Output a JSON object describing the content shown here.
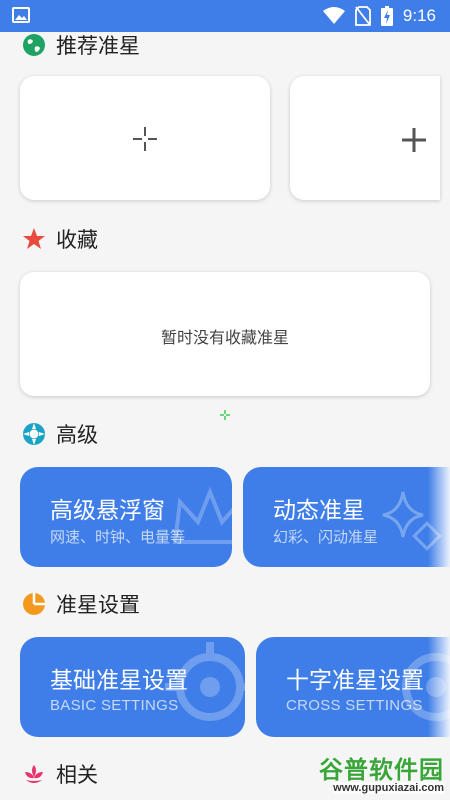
{
  "status_bar": {
    "time": "9:16",
    "icons": [
      "image-icon",
      "wifi-icon",
      "no-sim-icon",
      "battery-charging-icon"
    ]
  },
  "sections": {
    "recommended": {
      "title": "推荐准星",
      "icon": "globe-icon",
      "icon_color": "#1ea362"
    },
    "favorites": {
      "title": "收藏",
      "icon": "star-icon",
      "icon_color": "#e84a3c",
      "empty_text": "暂时没有收藏准星"
    },
    "advanced": {
      "title": "高级",
      "icon": "lifebuoy-icon",
      "icon_color": "#1aa3c6"
    },
    "settings": {
      "title": "准星设置",
      "icon": "pie-icon",
      "icon_color": "#f39a1e"
    },
    "related": {
      "title": "相关",
      "icon": "lotus-icon",
      "icon_color": "#e8336b"
    }
  },
  "advanced_cards": [
    {
      "title": "高级悬浮窗",
      "subtitle": "网速、时钟、电量等"
    },
    {
      "title": "动态准星",
      "subtitle": "幻彩、闪动准星"
    }
  ],
  "settings_cards": [
    {
      "title": "基础准星设置",
      "subtitle": "BASIC SETTINGS"
    },
    {
      "title": "十字准星设置",
      "subtitle": "CROSS SETTINGS"
    }
  ],
  "watermark": {
    "main": "谷普软件园",
    "url": "www.gupuxiazai.com"
  },
  "colors": {
    "accent": "#3f7ee8",
    "card": "#ffffff",
    "background": "#f5f5f5"
  }
}
